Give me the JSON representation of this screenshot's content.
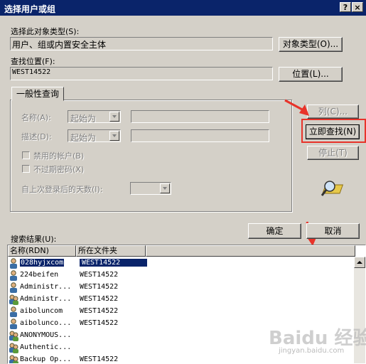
{
  "window": {
    "title": "选择用户或组",
    "help": "?",
    "close": "×"
  },
  "object_type": {
    "label": "选择此对象类型(S):",
    "value": "用户、组或内置安全主体",
    "button": "对象类型(O)..."
  },
  "location": {
    "label": "查找位置(F):",
    "value": "WEST14522",
    "button": "位置(L)..."
  },
  "query": {
    "tab": "一般性查询",
    "name_label": "名称(A):",
    "desc_label": "描述(D):",
    "starts_with": "起始为",
    "disabled_accounts": "禁用的帐户(B)",
    "no_expire_pwd": "不过期密码(X)",
    "days_since_login": "自上次登录后的天数(I):"
  },
  "side_buttons": {
    "columns": "列(C)...",
    "find_now": "立即查找(N)",
    "stop": "停止(T)"
  },
  "dialog_buttons": {
    "ok": "确定",
    "cancel": "取消"
  },
  "results": {
    "label": "搜索结果(U):",
    "columns": [
      "名称(RDN)",
      "所在文件夹"
    ],
    "rows": [
      {
        "name": "028hyjxcom",
        "folder": "WEST14522",
        "icon": "user-icon",
        "selected": true
      },
      {
        "name": "224beifen",
        "folder": "WEST14522",
        "icon": "user-icon"
      },
      {
        "name": "Administr...",
        "folder": "WEST14522",
        "icon": "user-icon"
      },
      {
        "name": "Administr...",
        "folder": "WEST14522",
        "icon": "group-icon"
      },
      {
        "name": "aiboluncom",
        "folder": "WEST14522",
        "icon": "user-icon"
      },
      {
        "name": "aiboluncо...",
        "folder": "WEST14522",
        "icon": "user-icon"
      },
      {
        "name": "ANONYMOUS...",
        "folder": "",
        "icon": "group-icon"
      },
      {
        "name": "Authentic...",
        "folder": "",
        "icon": "group-icon"
      },
      {
        "name": "Backup Op...",
        "folder": "WEST14522",
        "icon": "group-icon"
      }
    ]
  },
  "watermark": "Baidu 经验",
  "watermark_sub": "jingyan.baidu.com",
  "colors": {
    "titlebar": "#0a246a",
    "highlight": "#e8332a"
  }
}
